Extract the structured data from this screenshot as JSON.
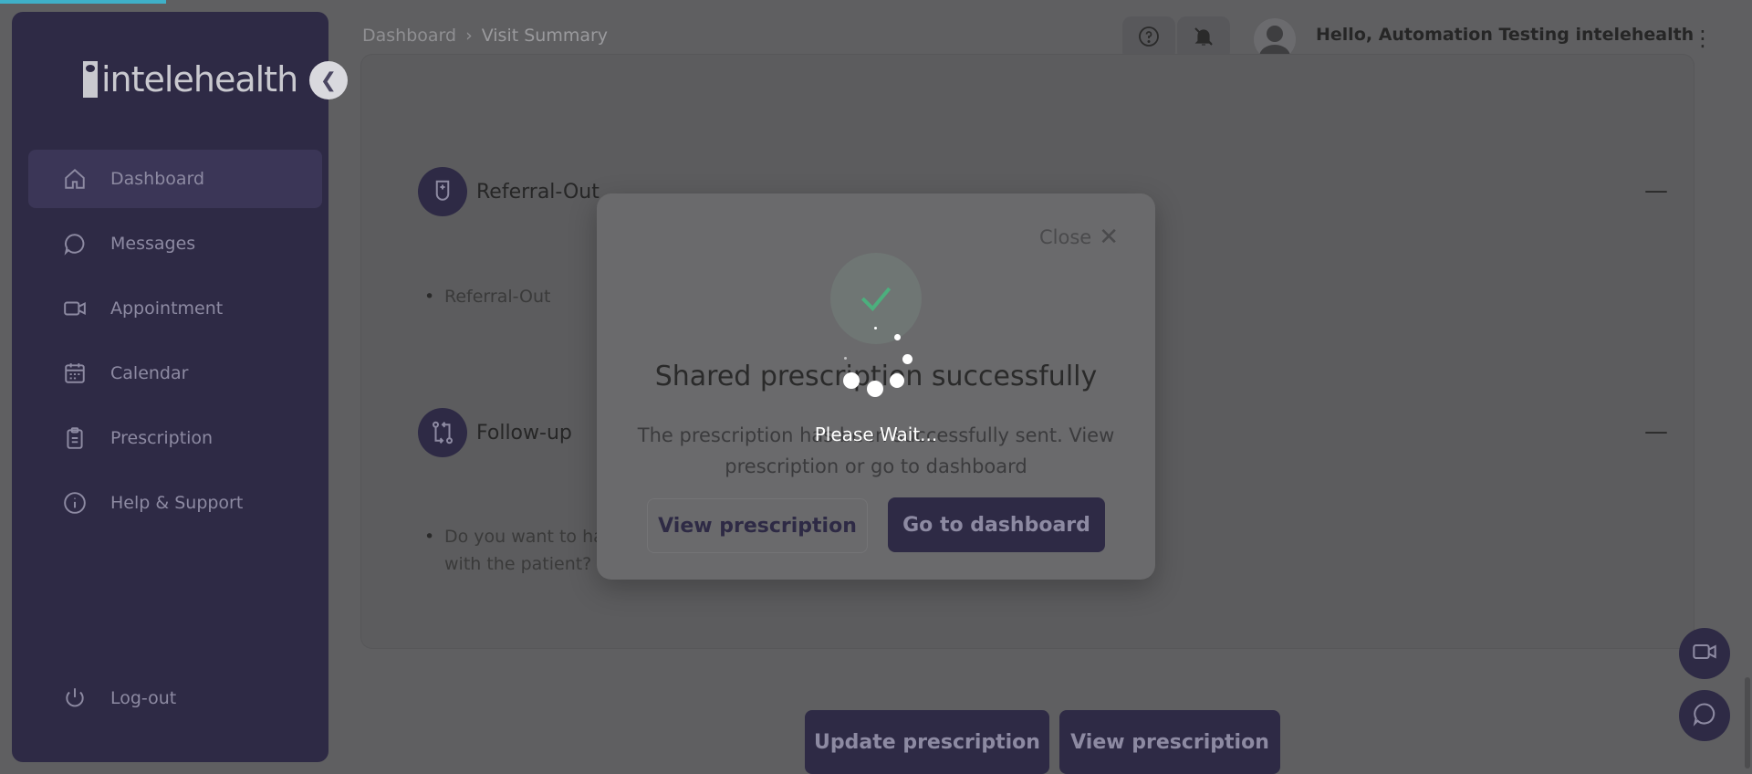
{
  "app": {
    "logo_text": "intelehealth"
  },
  "sidebar": {
    "items": [
      {
        "label": "Dashboard",
        "icon": "home-icon",
        "active": true
      },
      {
        "label": "Messages",
        "icon": "chat-icon"
      },
      {
        "label": "Appointment",
        "icon": "video-icon"
      },
      {
        "label": "Calendar",
        "icon": "calendar-icon"
      },
      {
        "label": "Prescription",
        "icon": "clipboard-icon"
      },
      {
        "label": "Help & Support",
        "icon": "info-icon"
      }
    ],
    "logout_label": "Log-out"
  },
  "header": {
    "breadcrumb_root": "Dashboard",
    "breadcrumb_current": "Visit Summary",
    "greeting": "Hello, Automation Testing intelehealth"
  },
  "sections": {
    "referral": {
      "title": "Referral-Out",
      "item": "Referral-Out"
    },
    "followup": {
      "title": "Follow-up",
      "item_line1": "Do you want to ha",
      "item_line2": "with the patient?"
    }
  },
  "actions": {
    "update_prescription": "Update prescription",
    "view_prescription": "View prescription"
  },
  "modal": {
    "close_label": "Close",
    "title": "Shared prescription successfully",
    "text": "The prescription has been successfully sent. View prescription or go to dashboard",
    "view_button": "View prescription",
    "dashboard_button": "Go to dashboard"
  },
  "loader": {
    "text": "Please Wait..."
  },
  "colors": {
    "brand": "#2e2a45",
    "progress": "#3fb0c8",
    "success": "#4caf7d"
  }
}
